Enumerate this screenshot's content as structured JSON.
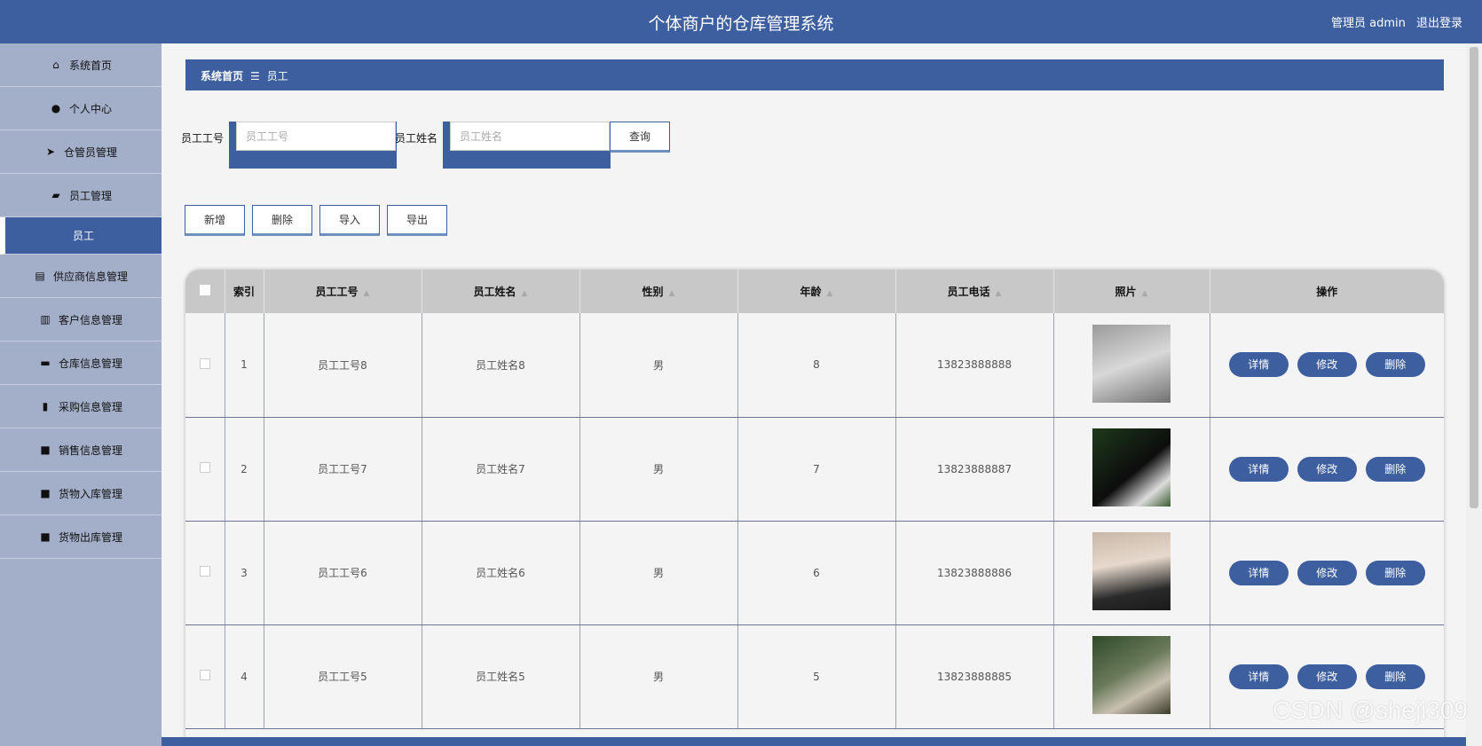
{
  "header": {
    "title": "个体商户的仓库管理系统",
    "user_label": "管理员 admin",
    "logout_label": "退出登录"
  },
  "sidebar": {
    "items": [
      {
        "label": "系统首页",
        "icon": "home-icon"
      },
      {
        "label": "个人中心",
        "icon": "user-icon"
      },
      {
        "label": "仓管员管理",
        "icon": "send-icon"
      },
      {
        "label": "员工管理",
        "icon": "folder-icon"
      },
      {
        "label": "员工",
        "icon": "",
        "active": true
      },
      {
        "label": "供应商信息管理",
        "icon": "briefcase-icon"
      },
      {
        "label": "客户信息管理",
        "icon": "books-icon"
      },
      {
        "label": "仓库信息管理",
        "icon": "ticket-icon"
      },
      {
        "label": "采购信息管理",
        "icon": "bar-chart-icon"
      },
      {
        "label": "销售信息管理",
        "icon": "grid-icon"
      },
      {
        "label": "货物入库管理",
        "icon": "grid-icon"
      },
      {
        "label": "货物出库管理",
        "icon": "grid-icon"
      }
    ]
  },
  "breadcrumb": {
    "home": "系统首页",
    "sep": "☰",
    "current": "员工"
  },
  "search": {
    "id_label": "员工工号",
    "id_placeholder": "员工工号",
    "id_value": "",
    "name_label": "员工姓名",
    "name_placeholder": "员工姓名",
    "name_value": "",
    "query_label": "查询"
  },
  "actions": {
    "add": "新增",
    "delete": "删除",
    "import": "导入",
    "export": "导出"
  },
  "table": {
    "headers": [
      "索引",
      "员工工号",
      "员工姓名",
      "性别",
      "年龄",
      "员工电话",
      "照片",
      "操作"
    ],
    "row_actions": {
      "detail": "详情",
      "edit": "修改",
      "delete": "删除"
    },
    "rows": [
      {
        "index": "1",
        "emp_id": "员工工号8",
        "name": "员工姓名8",
        "gender": "男",
        "age": "8",
        "phone": "13823888888"
      },
      {
        "index": "2",
        "emp_id": "员工工号7",
        "name": "员工姓名7",
        "gender": "男",
        "age": "7",
        "phone": "13823888887"
      },
      {
        "index": "3",
        "emp_id": "员工工号6",
        "name": "员工姓名6",
        "gender": "男",
        "age": "6",
        "phone": "13823888886"
      },
      {
        "index": "4",
        "emp_id": "员工工号5",
        "name": "员工姓名5",
        "gender": "男",
        "age": "5",
        "phone": "13823888885"
      }
    ]
  },
  "watermark": "CSDN @sheji309",
  "colors": {
    "primary": "#3d5f9f",
    "sidebar": "#a3aec9",
    "header_row": "#c8c8c8"
  }
}
